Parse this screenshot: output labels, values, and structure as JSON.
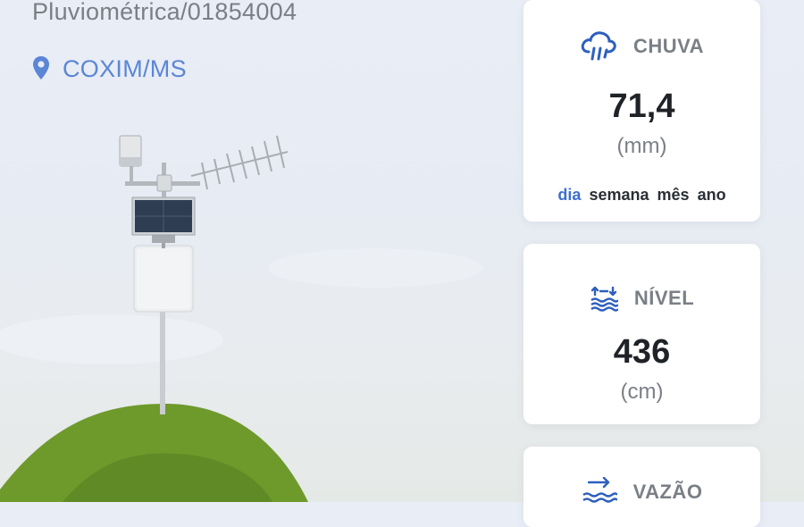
{
  "station": {
    "code": "Pluviométrica/01854004",
    "location": "COXIM/MS"
  },
  "icons": {
    "pin": "location-pin-icon",
    "rain": "rain-cloud-icon",
    "level": "water-level-icon",
    "flow": "water-flow-icon"
  },
  "colors": {
    "accent": "#3b6fd0",
    "location_text": "#5b86d6",
    "hill": "#6e9a2c"
  },
  "cards": {
    "rain": {
      "title": "CHUVA",
      "value": "71,4",
      "unit": "(mm)",
      "periods": [
        "dia",
        "semana",
        "mês",
        "ano"
      ],
      "active_period": "dia"
    },
    "level": {
      "title": "NÍVEL",
      "value": "436",
      "unit": "(cm)"
    },
    "flow": {
      "title": "VAZÃO"
    }
  }
}
